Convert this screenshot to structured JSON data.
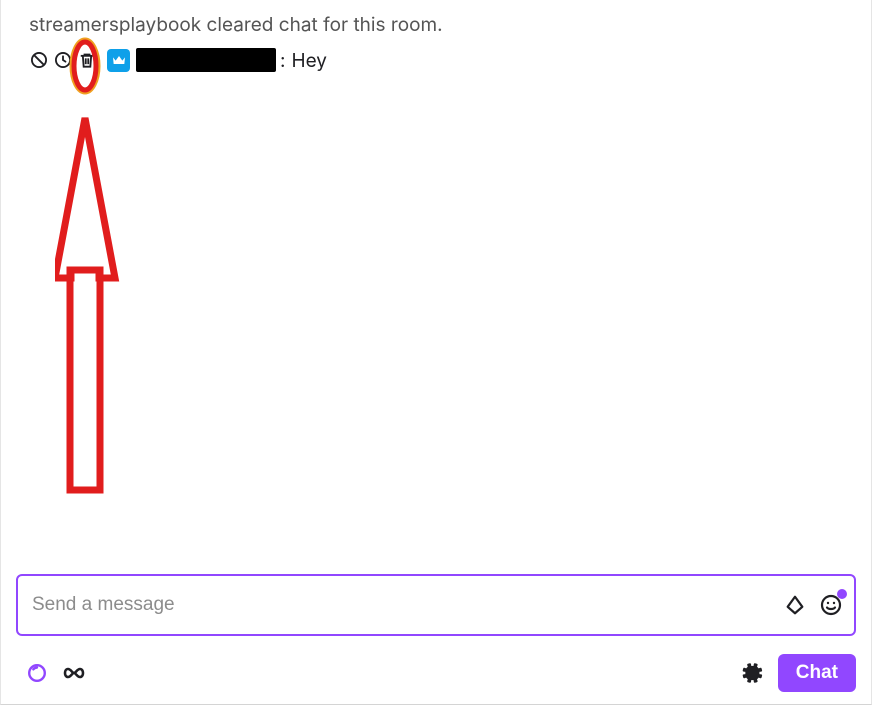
{
  "system_message": "streamersplaybook cleared chat for this room.",
  "chat": {
    "message_text": "Hey",
    "separator": ":"
  },
  "input": {
    "placeholder": "Send a message"
  },
  "buttons": {
    "chat": "Chat"
  },
  "colors": {
    "accent": "#9147ff",
    "badge": "#0ea0e9",
    "annotation": "#e11d1d"
  },
  "icons": {
    "ban": "ban-icon",
    "timeout": "clock-icon",
    "delete": "trash-icon",
    "badge": "crown-icon",
    "bits": "bits-icon",
    "emoji": "smiley-icon",
    "points": "points-icon",
    "infinity": "infinity-icon",
    "settings": "gear-icon"
  }
}
